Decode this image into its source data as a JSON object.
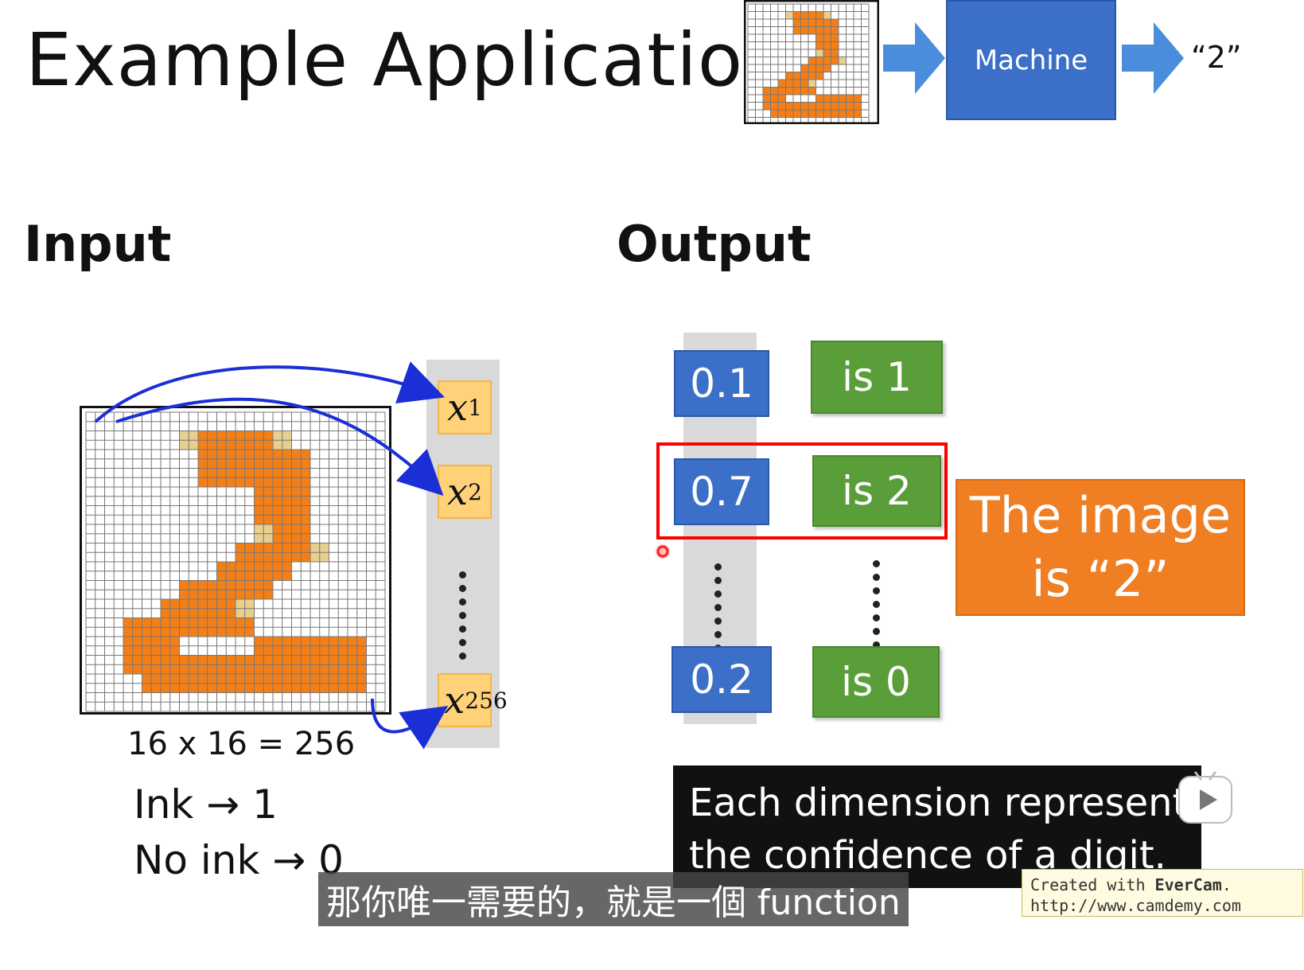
{
  "title": "Example Application",
  "pipeline": {
    "machine_label": "Machine",
    "output_label": "“2”"
  },
  "input": {
    "heading": "Input",
    "grid_caption": "16 x 16 = 256",
    "ink_rule": "Ink → 1",
    "no_ink_rule": "No ink → 0",
    "vector": [
      {
        "var": "x",
        "sub": "1"
      },
      {
        "var": "x",
        "sub": "2"
      },
      {
        "var": "x",
        "sub": "256"
      }
    ]
  },
  "output": {
    "heading": "Output",
    "rows": [
      {
        "value": "0.1",
        "label": "is 1"
      },
      {
        "value": "0.7",
        "label": "is 2"
      },
      {
        "value": "0.2",
        "label": "is 0"
      }
    ],
    "result": [
      "The image",
      "is  “2”"
    ]
  },
  "caption": [
    "Each dimension represents",
    "the confidence of a digit."
  ],
  "subtitle": "那你唯一需要的，就是一個 function",
  "watermark": {
    "line1_prefix": "Created with ",
    "line1_brand": "EverCam",
    "line1_suffix": ".",
    "line2": "http://www.camdemy.com"
  },
  "colors": {
    "ink": "#f57f17",
    "ink_light": "#e8cf8e",
    "blue_box": "#3b6fc8",
    "green_box": "#5a9e3a",
    "highlight_frame": "#ff0000",
    "arrow": "#1a2fd6",
    "pipe_arrow": "#4a8ddc"
  }
}
